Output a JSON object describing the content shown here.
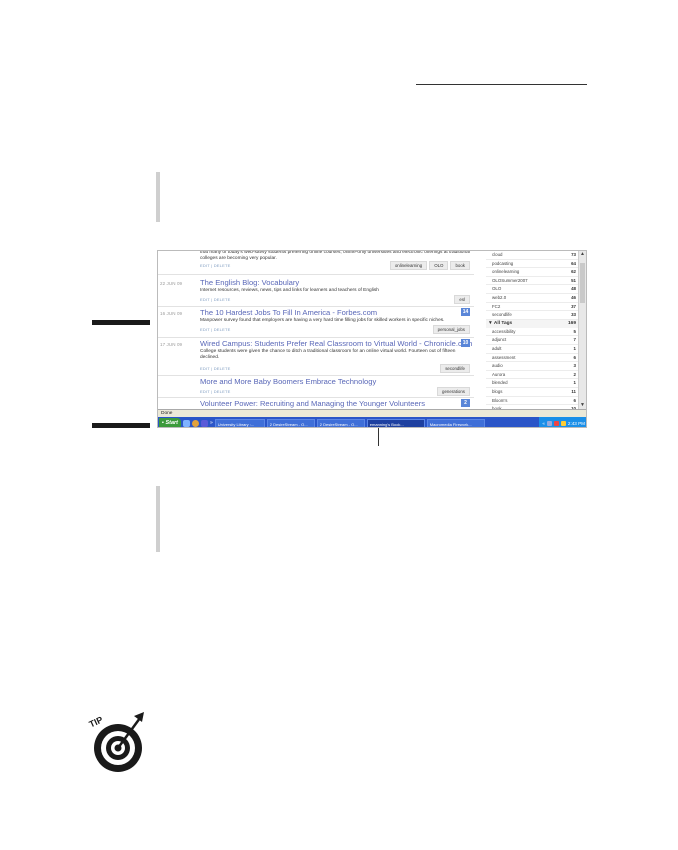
{
  "entries": [
    {
      "date": "",
      "title": "",
      "desc": "that many of today's web-savvy students preferring online courses, online-only universities and electronic offerings at traditional colleges are becoming very popular.",
      "actions": "EDIT | DELETE",
      "tags": [
        "onlinelearning",
        "OLO",
        "book"
      ],
      "count": ""
    },
    {
      "date": "22 JUN 09",
      "title": "The English Blog: Vocabulary",
      "desc": "Internet resources, reviews, news, tips and links for learners and teachers of English",
      "actions": "EDIT | DELETE",
      "tags": [
        "esl"
      ],
      "count": ""
    },
    {
      "date": "16 JUN 09",
      "title": "The 10 Hardest Jobs To Fill In America - Forbes.com",
      "desc": "Manpower survey found that employers are having a very hard time filling jobs for skilled workers in specific niches.",
      "actions": "EDIT | DELETE",
      "tags": [
        "personal_jobs"
      ],
      "count": "14"
    },
    {
      "date": "17 JUN 09",
      "title": "Wired Campus: Students Prefer Real Classroom to Virtual World - Chronicle.com",
      "desc": "College students were given the chance to ditch a traditional classroom for an online virtual world. Fourteen out of fifteen declined.",
      "actions": "EDIT | DELETE",
      "tags": [
        "secondlife"
      ],
      "count": "10"
    },
    {
      "date": "",
      "title": "More and More Baby Boomers Embrace Technology",
      "desc": "",
      "actions": "EDIT | DELETE",
      "tags": [
        "generations"
      ],
      "count": ""
    },
    {
      "date": "",
      "title": "Volunteer Power: Recruiting and Managing the Younger Volunteers",
      "desc": "",
      "actions": "",
      "tags": [],
      "count": "2"
    }
  ],
  "sidebar": {
    "top_tags": [
      {
        "name": "cloud",
        "count": "73"
      },
      {
        "name": "podcasting",
        "count": "64"
      },
      {
        "name": "onlinelearning",
        "count": "62"
      },
      {
        "name": "OLOSummer2007",
        "count": "51"
      },
      {
        "name": "OLO",
        "count": "48"
      },
      {
        "name": "web2.0",
        "count": "46"
      },
      {
        "name": "FC2",
        "count": "37"
      },
      {
        "name": "secondlife",
        "count": "33"
      }
    ],
    "all_tags_label": "All Tags",
    "all_tags_count": "169",
    "all_tags": [
      {
        "name": "accessibility",
        "count": "5"
      },
      {
        "name": "adjunct",
        "count": "7"
      },
      {
        "name": "adult",
        "count": "1"
      },
      {
        "name": "assessment",
        "count": "6"
      },
      {
        "name": "audio",
        "count": "3"
      },
      {
        "name": "Aurora",
        "count": "2"
      },
      {
        "name": "blended",
        "count": "1"
      },
      {
        "name": "blogs",
        "count": "11"
      },
      {
        "name": "Bloom's",
        "count": "6"
      },
      {
        "name": "book",
        "count": "10"
      }
    ]
  },
  "statusbar": {
    "text": "Done"
  },
  "taskbar": {
    "start_label": "Start",
    "buttons": [
      {
        "label": "University Library :...",
        "active": false
      },
      {
        "label": "2 DesireStream - O...",
        "active": false
      },
      {
        "label": "2 DesireStream - O...",
        "active": false
      },
      {
        "label": "emanning's Book...",
        "active": true
      },
      {
        "label": "Macromedia Firework...",
        "active": false
      }
    ],
    "clock": "2:43 PM"
  },
  "tip_icon": {
    "label": "TIP",
    "name": "tip-target-icon"
  },
  "colors": {
    "link": "#5a68b8",
    "taskbar": "#2a55c8",
    "badge": "#5a86d8"
  }
}
